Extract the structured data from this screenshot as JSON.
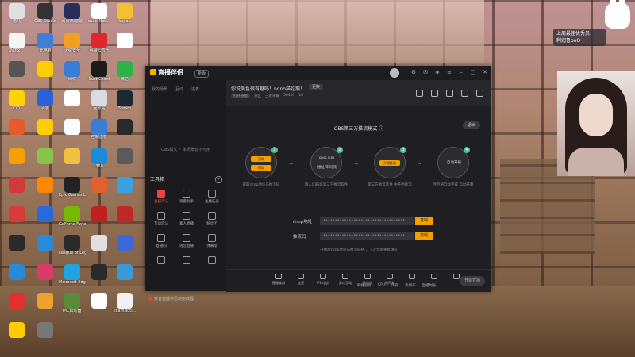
{
  "desktop": {
    "icons": [
      {
        "label": "猫儿",
        "color": "#e0e0e0"
      },
      {
        "label": "OBS Studio",
        "color": "#333333"
      },
      {
        "label": "网易UU加速",
        "color": "#2a2f5a"
      },
      {
        "label": "examNoti...",
        "color": "#ffffff"
      },
      {
        "label": "kugou",
        "color": "#f2c030"
      },
      {
        "label": "新建文...",
        "color": "#f5f5f5"
      },
      {
        "label": "此电脑",
        "color": "#3f7fd8"
      },
      {
        "label": "火绒安全",
        "color": "#f0a020"
      },
      {
        "label": "网易云音乐",
        "color": "#e0282c"
      },
      {
        "label": "",
        "color": "#ffffff"
      },
      {
        "label": "",
        "color": "#555555"
      },
      {
        "label": "",
        "color": "#ffcc00"
      },
      {
        "label": "网络",
        "color": "#3a7dd8"
      },
      {
        "label": "Rust Client",
        "color": "#1b1b1b"
      },
      {
        "label": "微信",
        "color": "#2bb34a"
      },
      {
        "label": "QQ",
        "color": "#ffd200"
      },
      {
        "label": "百度",
        "color": "#2a61d8"
      },
      {
        "label": "",
        "color": "#ffffff"
      },
      {
        "label": "回收站",
        "color": "#d9dde3"
      },
      {
        "label": "Steam",
        "color": "#1b2838"
      },
      {
        "label": "",
        "color": "#e55b2a"
      },
      {
        "label": "",
        "color": "#ffcc00"
      },
      {
        "label": "",
        "color": "#ffffff"
      },
      {
        "label": "控制面板",
        "color": "#3a7dd8"
      },
      {
        "label": "",
        "color": "#2a2a2a"
      },
      {
        "label": "",
        "color": "#f4a000"
      },
      {
        "label": "",
        "color": "#88c34a"
      },
      {
        "label": "",
        "color": "#f0c040"
      },
      {
        "label": "360",
        "color": "#1a8bd8"
      },
      {
        "label": "",
        "color": "#5a5a5a"
      },
      {
        "label": "",
        "color": "#d03a3a"
      },
      {
        "label": "",
        "color": "#ff8800"
      },
      {
        "label": "Epic Games Launcher",
        "color": "#222222"
      },
      {
        "label": "",
        "color": "#e06030"
      },
      {
        "label": "",
        "color": "#3aa0e0"
      },
      {
        "label": "",
        "color": "#d83a3a"
      },
      {
        "label": "",
        "color": "#2a6ad8"
      },
      {
        "label": "GeForce Experience",
        "color": "#76b900"
      },
      {
        "label": "",
        "color": "#c02020"
      },
      {
        "label": "",
        "color": "#c02828"
      },
      {
        "label": "",
        "color": "#2a2a2a"
      },
      {
        "label": "",
        "color": "#2a8ad8"
      },
      {
        "label": "League of Legends",
        "color": "#2a2a2a"
      },
      {
        "label": "",
        "color": "#e0e0e0"
      },
      {
        "label": "",
        "color": "#3a6ad8"
      },
      {
        "label": "",
        "color": "#2a88d8"
      },
      {
        "label": "",
        "color": "#d83a6a"
      },
      {
        "label": "Microsoft Edge",
        "color": "#1fa3e0"
      },
      {
        "label": "",
        "color": "#2a2a2a"
      },
      {
        "label": "",
        "color": "#3a9ad8"
      },
      {
        "label": "",
        "color": "#e03030"
      },
      {
        "label": "",
        "color": "#f0a030"
      },
      {
        "label": "MC启动器",
        "color": "#5a8a3a"
      },
      {
        "label": "",
        "color": "#ffffff"
      },
      {
        "label": "examNoti...",
        "color": "#f0f0f0"
      },
      {
        "label": "",
        "color": "#ffcc00"
      },
      {
        "label": "",
        "color": "#777777"
      }
    ]
  },
  "notice": {
    "line1": "上周最佳优秀员:",
    "line2": "利润鲁ooO"
  },
  "app": {
    "logo": "直播伴侣",
    "version": "新版",
    "left": {
      "tabs": [
        "我的场景",
        "互动",
        "连麦"
      ],
      "empty_hint": "OBS模式下 串场景暂不可用",
      "tools_title": "工具箱",
      "tools": [
        {
          "label": "直播玩法",
          "hot": true
        },
        {
          "label": "观看助手",
          "hot": false
        },
        {
          "label": "主播任务",
          "hot": false
        },
        {
          "label": "互动玩法",
          "hot": false
        },
        {
          "label": "素人直播",
          "hot": false
        },
        {
          "label": "粉丝团",
          "hot": false
        },
        {
          "label": "直播间",
          "hot": false
        },
        {
          "label": "语音直播",
          "hot": false
        },
        {
          "label": "弹幕墙",
          "hot": false
        },
        {
          "label": "",
          "hot": false
        },
        {
          "label": "",
          "hot": false
        },
        {
          "label": "",
          "hot": false
        }
      ],
      "footer": "抖音直播伴侣使用教程"
    },
    "room": {
      "title": "你说美色很有魅吗！nono猫吃鹅！！",
      "edit": "更换",
      "metas": [
        "打开链接",
        "分区",
        "王者荣耀",
        "56403",
        "28"
      ]
    },
    "panel": {
      "mode_title": "OBS第三方推流模式 ⓘ",
      "exit": "退出",
      "steps": [
        {
          "num": "1",
          "lines": [
            "获取",
            "获取"
          ],
          "caption": "获取rtmp地址与推流码"
        },
        {
          "num": "2",
          "lines": [
            "RMS URL",
            "推址/串码流"
          ],
          "caption": "填入OBS等第三方推流软件"
        },
        {
          "num": "3",
          "lines": [
            "开播推流"
          ],
          "caption": "第三方推流软件 中开始推流"
        },
        {
          "num": "4",
          "lines": [
            "自动开播"
          ],
          "caption": "伴侣将自动完成 自动开播"
        }
      ],
      "rtmp_label": "rtmp地址",
      "rtmp_value": "•••••••••••••••••••••••••••••••••••",
      "key_label": "推流码",
      "key_value": "•••••••••••••••••••••••••••••••••••",
      "copy": "复制",
      "hint": "开播后rtmp地址与推流码将… 下次无需重复填写"
    },
    "bottom": [
      "直播美颜",
      "连麦",
      "PK对战",
      "游戏互动",
      "麦克风",
      "扬声器",
      "",
      "",
      ""
    ],
    "start": "开始直播",
    "status": [
      "网络良好",
      "CPU",
      "内存",
      "丢帧率",
      "直播时长"
    ]
  }
}
